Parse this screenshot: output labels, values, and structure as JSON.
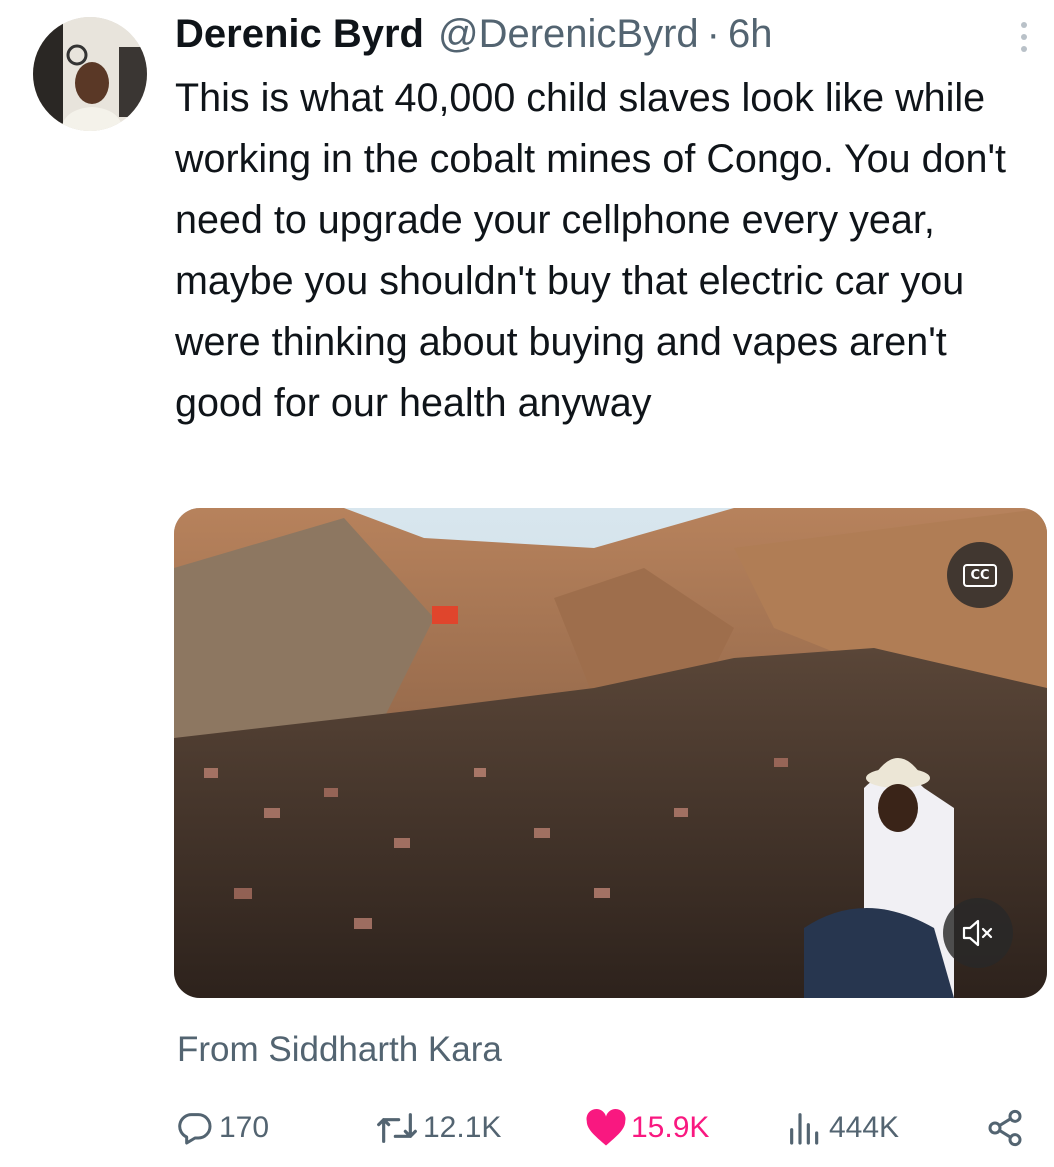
{
  "author": {
    "display_name": "Derenic Byrd",
    "handle": "@DerenicByrd",
    "separator": "·",
    "time": "6h"
  },
  "tweet": {
    "text": "This is what 40,000 child slaves look like while working in the cobalt mines of Congo. You don't need to upgrade your cellphone every year, maybe you shouldn't buy that electric car you were thinking about buying and vapes aren't good for our health anyway"
  },
  "media": {
    "cc_label": "CC",
    "muted": true
  },
  "source_line": "From Siddharth Kara",
  "actions": {
    "replies": "170",
    "retweets": "12.1K",
    "likes": "15.9K",
    "views": "444K",
    "liked": true
  },
  "colors": {
    "secondary_text": "#536471",
    "like_pink": "#f91880",
    "text": "#0f1419"
  },
  "icons": [
    "more-icon",
    "cc-icon",
    "mute-icon",
    "reply-icon",
    "retweet-icon",
    "heart-icon",
    "views-icon",
    "share-icon"
  ]
}
